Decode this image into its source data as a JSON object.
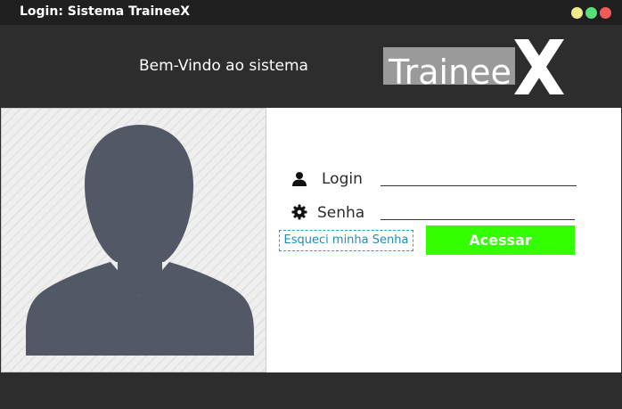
{
  "window": {
    "title": "Login: Sistema TraineeX"
  },
  "header": {
    "welcome": "Bem-Vindo ao sistema",
    "logo_text": "Trainee",
    "logo_mark": "X"
  },
  "form": {
    "login_label": "Login",
    "login_value": "",
    "password_label": "Senha",
    "password_value": "",
    "forgot_label": "Esqueci minha Senha",
    "access_label": "Acessar"
  },
  "icons": {
    "login": "user-icon",
    "password": "gear-icon",
    "avatar": "user-avatar-placeholder"
  },
  "colors": {
    "accent_button": "#33ff00",
    "link": "#1d8fb8",
    "avatar_silhouette": "#525866",
    "chrome": "#2d2d2d"
  }
}
